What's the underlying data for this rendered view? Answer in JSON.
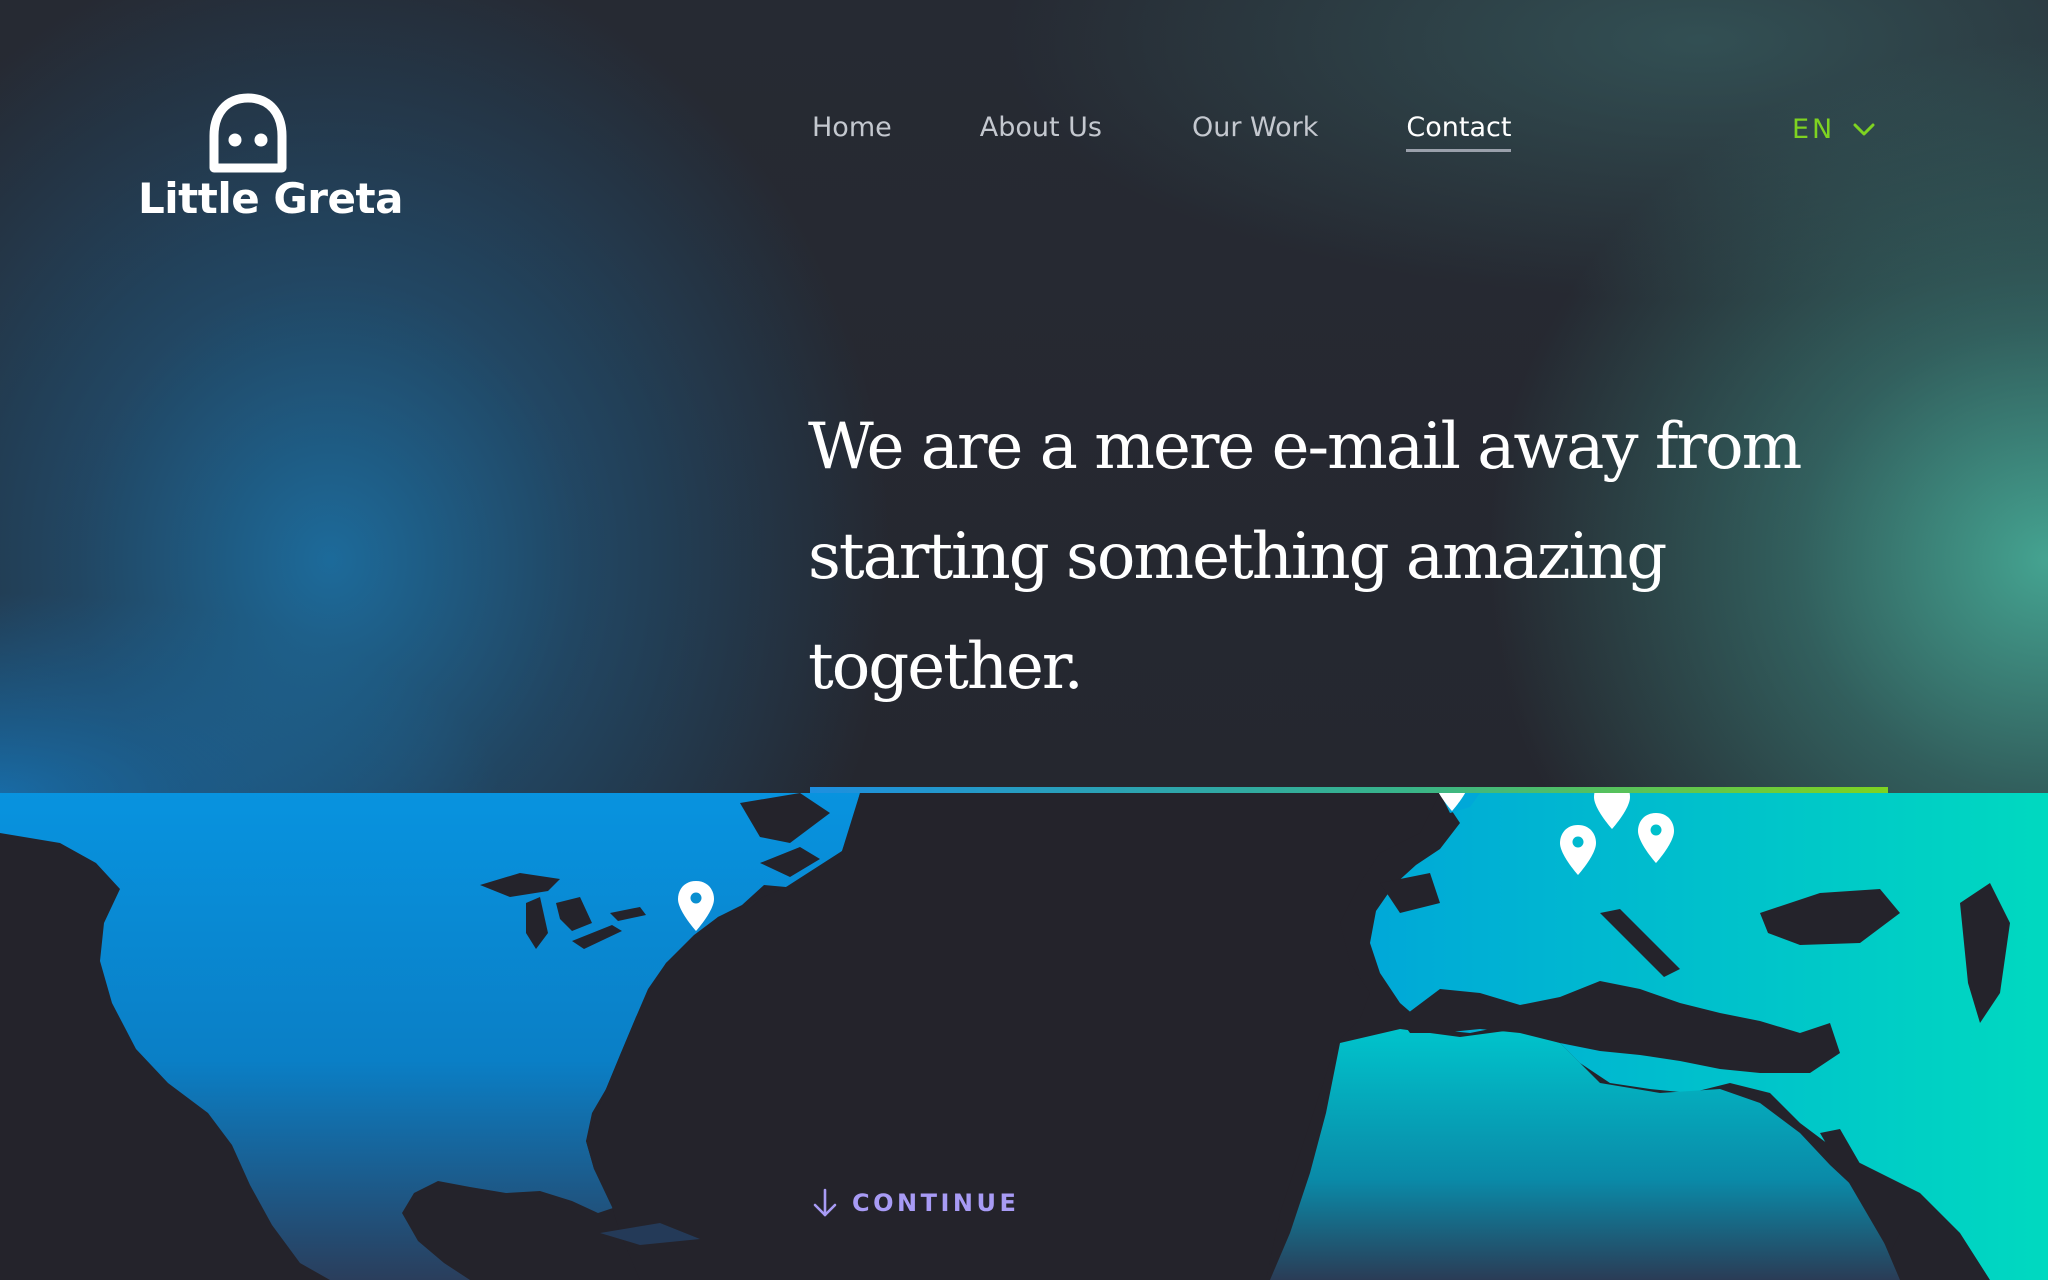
{
  "brand": {
    "name": "Little Greta",
    "logo_icon": "smiley-face-icon"
  },
  "nav": {
    "items": [
      {
        "label": "Home",
        "active": false
      },
      {
        "label": "About Us",
        "active": false
      },
      {
        "label": "Our Work",
        "active": false
      },
      {
        "label": "Contact",
        "active": true
      }
    ]
  },
  "language": {
    "selected": "EN",
    "icon": "chevron-down-icon"
  },
  "hero": {
    "headline": "We are a mere e-mail away from starting something amazing together."
  },
  "map": {
    "pins": [
      {
        "name": "map-pin-new-york"
      },
      {
        "name": "map-pin-london"
      },
      {
        "name": "map-pin-paris"
      },
      {
        "name": "map-pin-zurich"
      },
      {
        "name": "map-pin-munich"
      }
    ]
  },
  "cta": {
    "continue_label": "CONTINUE",
    "icon": "arrow-down-icon"
  },
  "colors": {
    "accent_green": "#7ed321",
    "accent_purple": "#a89bf5",
    "map_blue": "#0a8fd8",
    "map_teal": "#00c7b9",
    "background_dark": "#24232b"
  }
}
